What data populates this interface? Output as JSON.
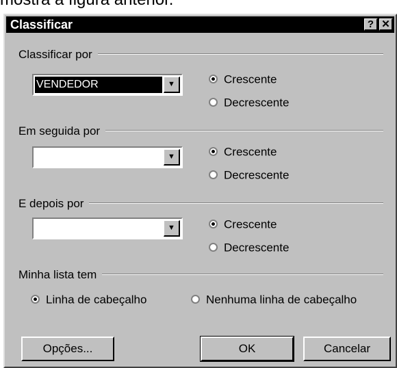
{
  "document": {
    "text": "mostra a figura anterior."
  },
  "dialog": {
    "title": "Classificar",
    "help_button": "?",
    "close_button": "✕",
    "sort1": {
      "label": "Classificar por",
      "value": "VENDEDOR",
      "ascending": "Crescente",
      "descending": "Decrescente",
      "selected": "ascending"
    },
    "sort2": {
      "label": "Em seguida por",
      "value": "",
      "ascending": "Crescente",
      "descending": "Decrescente",
      "selected": "ascending"
    },
    "sort3": {
      "label": "E depois por",
      "value": "",
      "ascending": "Crescente",
      "descending": "Decrescente",
      "selected": "ascending"
    },
    "header": {
      "label": "Minha lista tem",
      "option_header": "Linha de cabeçalho",
      "option_no_header": "Nenhuma linha de cabeçalho",
      "selected": "header"
    },
    "buttons": {
      "options": "Opções...",
      "ok": "OK",
      "cancel": "Cancelar"
    }
  }
}
